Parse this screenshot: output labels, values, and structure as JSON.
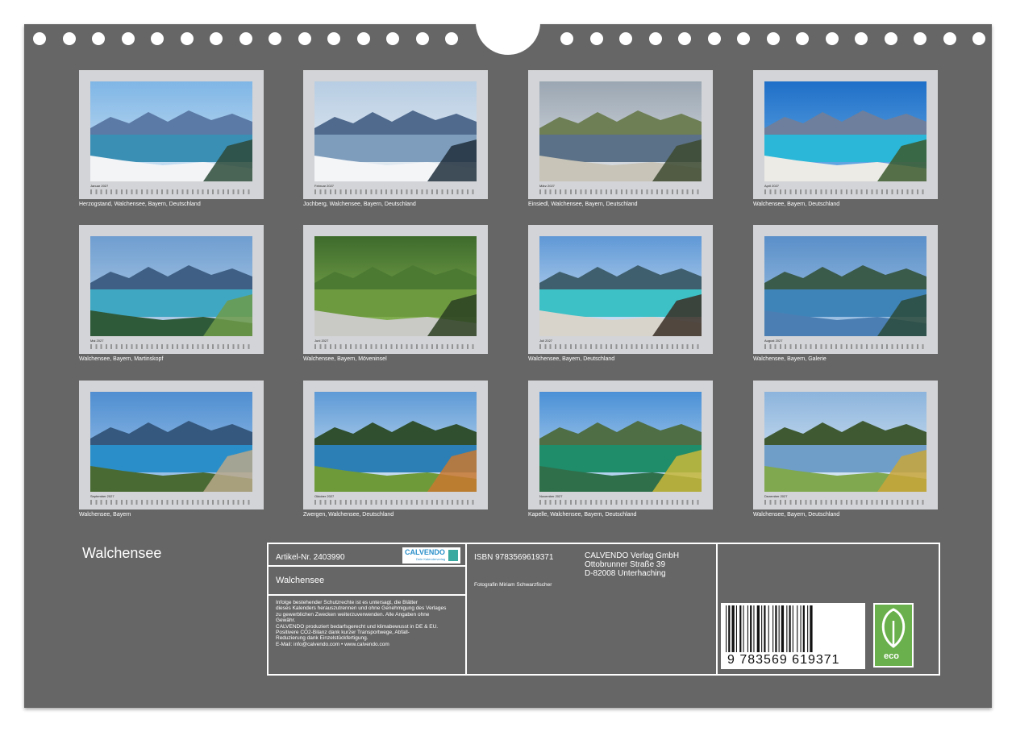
{
  "calendar_title": "Walchensee",
  "months": [
    {
      "name": "Januar 2027",
      "caption": "Herzogstand, Walchensee, Bayern, Deutschland",
      "theme": "snow"
    },
    {
      "name": "Februar 2027",
      "caption": "Jochberg, Walchensee, Bayern, Deutschland",
      "theme": "winter"
    },
    {
      "name": "März 2027",
      "caption": "Einsiedl, Walchensee, Bayern, Deutschland",
      "theme": "cloudy"
    },
    {
      "name": "April 2027",
      "caption": "Walchensee, Bayern, Deutschland",
      "theme": "beach"
    },
    {
      "name": "Mai 2027",
      "caption": "Walchensee, Bayern, Martinskopf",
      "theme": "aerial"
    },
    {
      "name": "Juni 2027",
      "caption": "Walchensee, Bayern, Möveninsel",
      "theme": "gulls"
    },
    {
      "name": "Juli 2027",
      "caption": "Walchensee, Bayern, Deutschland",
      "theme": "turquoise"
    },
    {
      "name": "August 2027",
      "caption": "Walchensee, Bayern, Galerie",
      "theme": "calm"
    },
    {
      "name": "September 2027",
      "caption": "Walchensee, Bayern",
      "theme": "aerial2"
    },
    {
      "name": "Oktober 2027",
      "caption": "Zwergen, Walchensee, Deutschland",
      "theme": "autumn"
    },
    {
      "name": "November 2027",
      "caption": "Kapelle, Walchensee, Bayern, Deutschland",
      "theme": "green"
    },
    {
      "name": "Dezember 2027",
      "caption": "Walchensee, Bayern, Deutschland",
      "theme": "mirror"
    }
  ],
  "info": {
    "article": "Artikel-Nr. 2403990",
    "logo_text": "CALVENDO",
    "logo_sub": "Dein Kalenderverlag",
    "product_title": "Walchensee",
    "legal": "Infolge bestehender Schutzrechte ist es untersagt, die Blätter\ndieses Kalenders herauszutrennen und ohne Genehmigung des Verlages\nzu gewerblichen Zwecken weiterzuverwenden. Alle Angaben ohne\nGewähr.\nCALVENDO produziert bedarfsgerecht und klimabewusst in DE & EU.\nPositivere CO2-Bilanz dank kurzer Transportwege, Abfall-\nReduzierung dank Einzelstückfertigung.\nE-Mail: info@calvendo.com • www.calvendo.com",
    "isbn": "ISBN 9783569619371",
    "photographer": "Fotografin Miriam Schwarzfischer",
    "publisher": "CALVENDO Verlag GmbH",
    "street": "Ottobrunner Straße 39",
    "city": "D-82008 Unterhaching",
    "barcode_number": "9 783569 619371",
    "eco_label": "eco"
  },
  "colors": {
    "board": "#666666",
    "eco_green": "#6ab04c"
  }
}
